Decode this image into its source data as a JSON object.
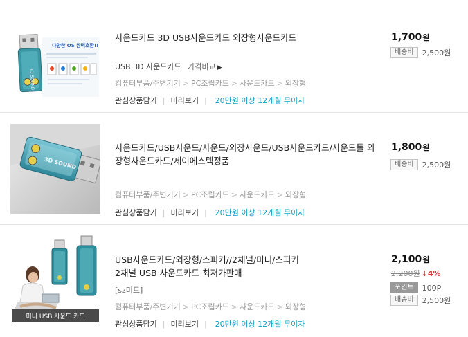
{
  "items": [
    {
      "title": "사운드카드 3D USB사운드카드 외장형사운드카드",
      "sub_label": "USB 3D 사운드카드",
      "compare_label": "가격비교",
      "categories": [
        "컴퓨터부품/주변기기",
        "PC조립카드",
        "사운드카드",
        "외장형"
      ],
      "actions": {
        "wish": "관심상품담기",
        "preview": "미리보기",
        "installment": "20만원 이상 12개월 무이자"
      },
      "price": "1,700",
      "won": "원",
      "shipping_label": "배송비",
      "shipping_fee": "2,500원",
      "thumb_text": {
        "headline": "다양한 OS 완벽호환!!",
        "os_logos": [
          "XP",
          "Vista",
          "7",
          "8",
          "Mac"
        ]
      }
    },
    {
      "title": "사운드카드/USB사운드/사운드/외장사운드/USB사운드카드/사운드틀 외장형사운드카드/제이에스텍정품",
      "categories": [
        "컴퓨터부품/주변기기",
        "PC조립카드",
        "사운드카드",
        "외장형"
      ],
      "actions": {
        "wish": "관심상품담기",
        "preview": "미리보기",
        "installment": "20만원 이상 12개월 무이자"
      },
      "price": "1,800",
      "won": "원",
      "shipping_label": "배송비",
      "shipping_fee": "2,500원",
      "thumb_text": {
        "label": "3D SOUND"
      }
    },
    {
      "title_line1": "USB사운드카드/외장형/스피커//2채널/미니/스피커",
      "title_line2": "2채널 USB 사운드카드 최저가판매",
      "seller": "[sz미트]",
      "categories": [
        "컴퓨터부품/주변기기",
        "PC조립카드",
        "사운드카드",
        "외장형"
      ],
      "actions": {
        "wish": "관심상품담기",
        "preview": "미리보기",
        "installment": "20만원 이상 12개월 무이자"
      },
      "price": "2,100",
      "won": "원",
      "old_price": "2,200원",
      "discount": "↓4%",
      "point_label": "포인트",
      "point_value": "100P",
      "shipping_label": "배송비",
      "shipping_fee": "2,500원",
      "thumb_text": {
        "caption": "미니 USB 사운드 카드"
      }
    }
  ],
  "colors": {
    "accent_free": "#0a9ec4",
    "discount": "#e03a3a",
    "divider": "#e3e3e3"
  },
  "icons": {
    "compare_arrow": "chevron-right-icon"
  }
}
